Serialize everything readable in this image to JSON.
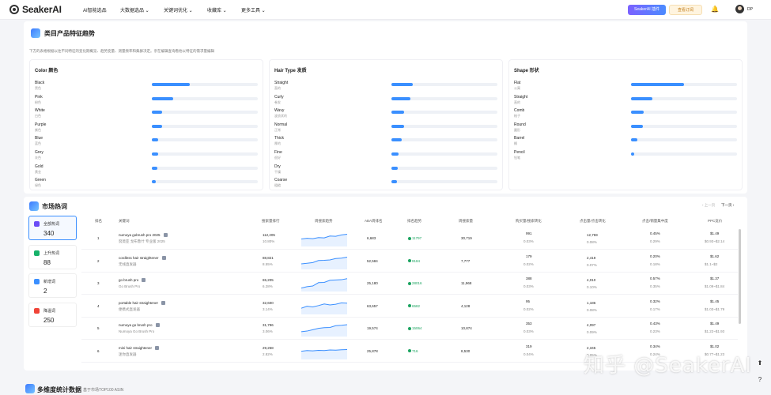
{
  "header": {
    "logo": "SeakerAI",
    "nav": [
      "AI智能选品",
      "大数据选品",
      "关键词优化",
      "收藏库",
      "更多工具"
    ],
    "ext_button": "SeakerAI 插件",
    "subscribe_button": "查看订阅",
    "user": "DP"
  },
  "trend": {
    "title": "类目产品特征趋势",
    "desc": "下方的表格根据以往不同特征的变化期概览、趋势变量、测量频率和集群决定。亲在编辑查询看他以特征的需求量编辑",
    "panels": [
      {
        "title": "Color 颜色",
        "rows": [
          {
            "name": "Black",
            "sub": "黑色",
            "value": 0.36
          },
          {
            "name": "Pink",
            "sub": "粉色",
            "value": 0.2
          },
          {
            "name": "White",
            "sub": "白色",
            "value": 0.1
          },
          {
            "name": "Purple",
            "sub": "紫色",
            "value": 0.1
          },
          {
            "name": "Blue",
            "sub": "蓝色",
            "value": 0.06
          },
          {
            "name": "Grey",
            "sub": "灰色",
            "value": 0.06
          },
          {
            "name": "Gold",
            "sub": "黄金",
            "value": 0.05
          },
          {
            "name": "Green",
            "sub": "绿色",
            "value": 0.04
          }
        ]
      },
      {
        "title": "Hair Type 发质",
        "rows": [
          {
            "name": "Straight",
            "sub": "直的",
            "value": 0.2
          },
          {
            "name": "Curly",
            "sub": "卷发",
            "value": 0.18
          },
          {
            "name": "Wavy",
            "sub": "波浪状的",
            "value": 0.12
          },
          {
            "name": "Normal",
            "sub": "正常",
            "value": 0.12
          },
          {
            "name": "Thick",
            "sub": "厚的",
            "value": 0.1
          },
          {
            "name": "Fine",
            "sub": "很好",
            "value": 0.07
          },
          {
            "name": "Dry",
            "sub": "干燥",
            "value": 0.06
          },
          {
            "name": "Coarse",
            "sub": "粗糙",
            "value": 0.05
          }
        ]
      },
      {
        "title": "Shape 形状",
        "rows": [
          {
            "name": "Flat",
            "sub": "公寓",
            "value": 0.5
          },
          {
            "name": "Straight",
            "sub": "直的",
            "value": 0.2
          },
          {
            "name": "Comb",
            "sub": "梳子",
            "value": 0.12
          },
          {
            "name": "Round",
            "sub": "圆形",
            "value": 0.11
          },
          {
            "name": "Barrel",
            "sub": "桶",
            "value": 0.06
          },
          {
            "name": "Pencil",
            "sub": "铅笔",
            "value": 0.03
          }
        ]
      }
    ]
  },
  "market": {
    "title": "市场热词",
    "prev": "上一页",
    "next": "下一页",
    "stats": [
      {
        "label": "全部热词",
        "value": "340",
        "color": "#6b4cf6"
      },
      {
        "label": "上升热词",
        "value": "88",
        "color": "#17b26a"
      },
      {
        "label": "新增词",
        "value": "2",
        "color": "#3a8fff"
      },
      {
        "label": "降温词",
        "value": "250",
        "color": "#f04438"
      }
    ],
    "columns": [
      "排名",
      "关键词",
      "搜索量排行",
      "周搜索趋势",
      "ABA周排名",
      "排名趋势",
      "周搜索量",
      "购买量/搜索转化",
      "点击量/点击转化",
      "点击/销量集中度",
      "PPC竞价"
    ],
    "rows": [
      {
        "rank": "1",
        "kw": "numoya gobrush pro 2025",
        "kw_cn": "努莫亚 戈布鲁什 专业版 2025",
        "rank_a": "112,205",
        "rank_b": "10.80%",
        "aba": "6,683",
        "trend": "11797",
        "search": "30,719",
        "buy": "991",
        "buy_pct": "0.03%",
        "click": "12,759",
        "click_pct": "0.08%",
        "conc": "0.45%",
        "conc2": "0.29%",
        "ppc": "$1.49",
        "ppc_range": "$0.93~$2.14",
        "spark": [
          0.5,
          0.55,
          0.52,
          0.6,
          0.58,
          0.72,
          0.7,
          0.8,
          0.85
        ]
      },
      {
        "rank": "2",
        "kw": "cordless hair straightener",
        "kw_cn": "无线直发器",
        "rank_a": "88,821",
        "rank_b": "8.55%",
        "aba": "52,584",
        "trend": "9184",
        "search": "7,777",
        "buy": "179",
        "buy_pct": "0.02%",
        "click": "2,419",
        "click_pct": "0.07%",
        "conc": "0.20%",
        "conc2": "0.18%",
        "ppc": "$1.62",
        "ppc_range": "$1.1~$2",
        "spark": [
          0.35,
          0.4,
          0.45,
          0.6,
          0.62,
          0.65,
          0.75,
          0.78,
          0.85
        ]
      },
      {
        "rank": "3",
        "kw": "go brush pro",
        "kw_cn": "Go Brush Pro",
        "rank_a": "65,205",
        "rank_b": "6.28%",
        "aba": "25,180",
        "trend": "28016",
        "search": "11,968",
        "buy": "388",
        "buy_pct": "0.03%",
        "click": "4,010",
        "click_pct": "0.10%",
        "conc": "0.57%",
        "conc2": "0.35%",
        "ppc": "$1.37",
        "ppc_range": "$1.09~$1.84",
        "spark": [
          0.2,
          0.3,
          0.35,
          0.6,
          0.62,
          0.78,
          0.8,
          0.82,
          0.9
        ]
      },
      {
        "rank": "4",
        "kw": "portable hair straightener",
        "kw_cn": "便携式直发器",
        "rank_a": "32,600",
        "rank_b": "3.14%",
        "aba": "63,657",
        "trend": "6582",
        "search": "4,128",
        "buy": "95",
        "buy_pct": "0.02%",
        "click": "1,186",
        "click_pct": "0.08%",
        "conc": "0.32%",
        "conc2": "0.17%",
        "ppc": "$1.45",
        "ppc_range": "$1.03~$1.79",
        "spark": [
          0.4,
          0.55,
          0.5,
          0.6,
          0.72,
          0.65,
          0.7,
          0.8,
          0.78
        ]
      },
      {
        "rank": "5",
        "kw": "numoya go brush pro",
        "kw_cn": "Numoya Go Brush Pro",
        "rank_a": "31,796",
        "rank_b": "3.06%",
        "aba": "19,574",
        "trend": "15064",
        "search": "10,874",
        "buy": "353",
        "buy_pct": "0.03%",
        "click": "4,097",
        "click_pct": "0.09%",
        "conc": "0.43%",
        "conc2": "0.23%",
        "ppc": "$1.49",
        "ppc_range": "$1.22~$1.93",
        "spark": [
          0.3,
          0.35,
          0.45,
          0.55,
          0.6,
          0.62,
          0.75,
          0.78,
          0.82
        ]
      },
      {
        "rank": "6",
        "kw": "mini hair straightener",
        "kw_cn": "迷你直发器",
        "rank_a": "29,258",
        "rank_b": "2.82%",
        "aba": "25,878",
        "trend": "716",
        "search": "8,530",
        "buy": "319",
        "buy_pct": "0.04%",
        "click": "2,345",
        "click_pct": "0.05%",
        "conc": "0.34%",
        "conc2": "0.24%",
        "ppc": "$1.02",
        "ppc_range": "$0.77~$1.23",
        "spark": [
          0.55,
          0.6,
          0.58,
          0.62,
          0.6,
          0.65,
          0.63,
          0.66,
          0.68
        ]
      }
    ]
  },
  "multi": {
    "title": "多维度统计数据",
    "subtitle": "基于市场TOP100 ASIN"
  },
  "watermark": "知乎 @SeakerAI"
}
